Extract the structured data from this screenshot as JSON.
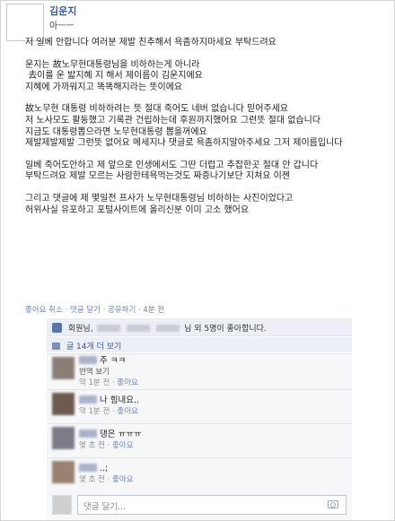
{
  "post": {
    "author": "김운지",
    "subline": "아ㅡㅡ",
    "paragraphs": [
      "저 일베 안합니다 여러분 제발 친추해서 욕좀하지마세요 부탁드려요",
      "운지는 故노무현대통령님을 비하하는게 아니라\n 去이를 운 밟지혜 지 해서 제이름이 김운지에요\n지혜에 가까워지고 똑똑해지라는 뜻이에요",
      "故노무현 대통령 비하하려는 뜻 절대 죽어도 네버 없습니다 믿어주세요\n저 노사모도 활동했고 기록관 건립하는데 후원까지했어요 그런뜻 절대 없습니다\n지금도 대통령뽑으라면 노무현대통령 뽑을꺼에요\n제발제발제발 그런뜻 없어요 메세지나 댓글로 욕좀하지말아주세요 그저 제이름입니다",
      "일베 죽어도안하고 제 앞으로 인생에서도 그딴 더럽고 추잡한곳 절대 안 갑니다\n부탁드려요 제발 모르는 사람한테욕먹는것도 짜증나기보단 지쳐요 이젠",
      "그리고 댓글에 제 몇일전 프사가 노무현대통령님 비하하는 사진이었다고\n허위사실 유포하고 포털사이트에 올리신분 이미 고소 했어요"
    ],
    "actions": {
      "like_cancel": "좋아요 취소",
      "comment": "댓글 달기",
      "share": "공유하기",
      "time": "4분 전"
    }
  },
  "likes": {
    "prefix": "회원님,",
    "suffix": "님 외 5명이 좋아합니다."
  },
  "view_more": "글 14개 더 보기",
  "comments": [
    {
      "text": "주 ㅋㅋ",
      "sub": "번역 보기",
      "time": "약 1분 전",
      "like": "좋아요"
    },
    {
      "text": "나 힘내요..",
      "sub": "",
      "time": "약 1분 전",
      "like": "좋아요"
    },
    {
      "text": "댕은 ㅠㅠㅠ",
      "sub": "",
      "time": "몇 초 전",
      "like": "좋아요"
    },
    {
      "text": "..;",
      "sub": "",
      "time": "몇 초 전",
      "like": "좋아요"
    }
  ],
  "reply": {
    "placeholder": "댓글 달기..."
  },
  "colors": {
    "link": "#3b5998",
    "comment_bg": "#f6f7f9",
    "likes_bg": "#eceff5"
  }
}
